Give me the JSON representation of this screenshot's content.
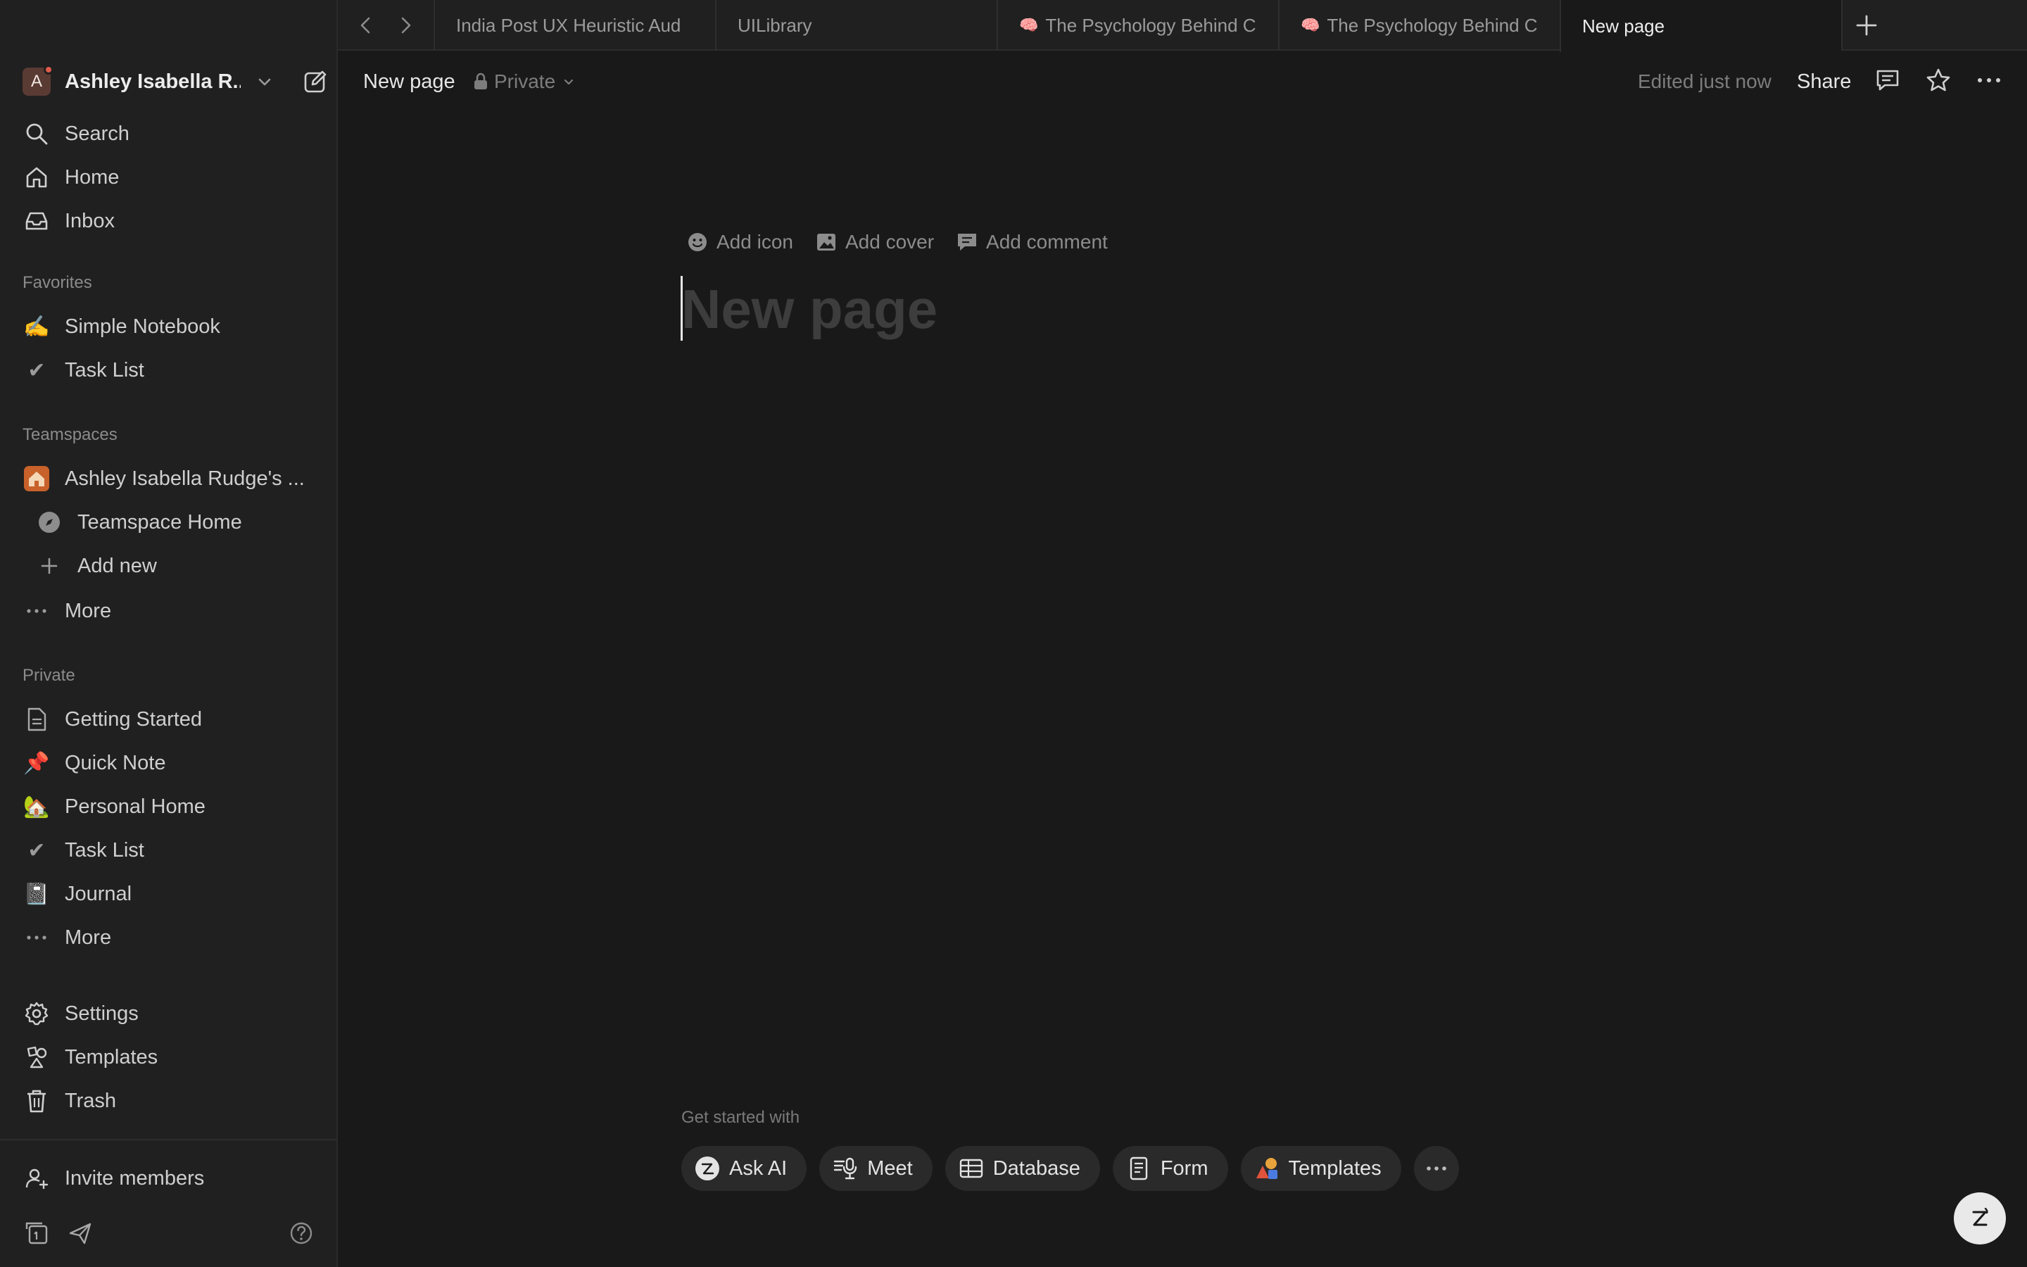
{
  "workspace": {
    "avatar_letter": "A",
    "name": "Ashley Isabella R..."
  },
  "nav": {
    "search": "Search",
    "home": "Home",
    "inbox": "Inbox"
  },
  "favorites": {
    "heading": "Favorites",
    "items": [
      {
        "emoji": "✍️",
        "label": "Simple Notebook"
      },
      {
        "emoji": "✔",
        "label": "Task List"
      }
    ]
  },
  "teamspaces": {
    "heading": "Teamspaces",
    "name": "Ashley Isabella Rudge's ...",
    "home": "Teamspace Home",
    "add_new": "Add new",
    "more": "More"
  },
  "private": {
    "heading": "Private",
    "items": [
      {
        "emoji": "",
        "label": "Getting Started"
      },
      {
        "emoji": "📌",
        "label": "Quick Note"
      },
      {
        "emoji": "🏡",
        "label": "Personal Home"
      },
      {
        "emoji": "✔",
        "label": "Task List"
      },
      {
        "emoji": "📓",
        "label": "Journal"
      }
    ],
    "more": "More"
  },
  "bottom_nav": {
    "settings": "Settings",
    "templates": "Templates",
    "trash": "Trash",
    "invite": "Invite members"
  },
  "tabs": [
    {
      "emoji": "",
      "label": "India Post UX Heuristic Aud",
      "active": false
    },
    {
      "emoji": "",
      "label": "UILibrary",
      "active": false
    },
    {
      "emoji": "🧠",
      "label": "The Psychology Behind C",
      "active": false
    },
    {
      "emoji": "🧠",
      "label": "The Psychology Behind C",
      "active": false
    },
    {
      "emoji": "",
      "label": "New page",
      "active": true
    }
  ],
  "header": {
    "breadcrumb": "New page",
    "privacy": "Private",
    "edited": "Edited just now",
    "share": "Share"
  },
  "page": {
    "add_icon": "Add icon",
    "add_cover": "Add cover",
    "add_comment": "Add comment",
    "title_placeholder": "New page"
  },
  "get_started": {
    "heading": "Get started with",
    "chips": [
      "Ask AI",
      "Meet",
      "Database",
      "Form",
      "Templates"
    ]
  },
  "colors": {
    "background": "#191919",
    "sidebar": "#202020",
    "chip": "#2a2a2a",
    "text": "#d4d4d4"
  }
}
